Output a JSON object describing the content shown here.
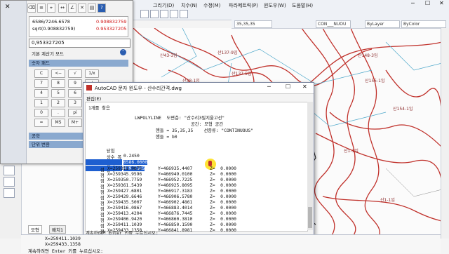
{
  "app": {
    "menu": [
      "그리기(D)",
      "치수(N)",
      "수정(M)",
      "파라메트릭(P)",
      "윈도우(W)",
      "도움말(H)"
    ],
    "toolbar": {
      "coord": "35,35,35",
      "linetype": "CON___NUOU",
      "layer_style": "ByLayer",
      "color": "ByColor"
    }
  },
  "calculator": {
    "history": [
      {
        "expr": "6586/7246.6578",
        "result": "0.908832759"
      },
      {
        "expr": "sqrt(0.908832759)",
        "result": "0.953327205"
      }
    ],
    "input": "0,953327205",
    "basic_mode_label": "기본 계산기 모드",
    "numpad_label": "숫자 패드",
    "keys": [
      [
        "C",
        "<--",
        "√",
        "1/x"
      ],
      [
        "7",
        "8",
        "9",
        "/"
      ],
      [
        "4",
        "5",
        "6",
        "*"
      ],
      [
        "1",
        "2",
        "3",
        "-"
      ],
      [
        "0",
        ".",
        "pi",
        ""
      ],
      [
        "=",
        "MS",
        "M+",
        ""
      ]
    ],
    "sections": [
      "공학",
      "단위 변환"
    ]
  },
  "textwin": {
    "title": "AutoCAD 문자 윈도우 - 산수리간격.dwg",
    "menu": "편집(E)",
    "sub_label": "1개를 찾음",
    "header": [
      "LWPOLYLINE  도면층: \"산수리3필지울고선\"",
      "공간: 모형 공간",
      "핸들 = 35,35,35    선종류: \"CONTINUOUS\"",
      "핸들 = b0"
    ],
    "props": [
      {
        "k": "닫힘",
        "v": ""
      },
      {
        "k": "상수 폭",
        "v": "0.2450"
      },
      {
        "k": "면적",
        "v": "6586.0000"
      },
      {
        "k": "둘레",
        "v": "419.7365"
      }
    ],
    "vertices": [
      {
        "x": "X=259311.9875",
        "y": "Y=466935.4407",
        "z": "Z=  0.0000"
      },
      {
        "x": "X=259345.9596",
        "y": "Y=466949.0100",
        "z": "Z=  0.0000"
      },
      {
        "x": "X=259350.7759",
        "y": "Y=466952.7225",
        "z": "Z=  0.0000"
      },
      {
        "x": "X=259361.5439",
        "y": "Y=466925.8095",
        "z": "Z=  0.0000"
      },
      {
        "x": "X=259427.6801",
        "y": "Y=466917.3183",
        "z": "Z=  0.0000"
      },
      {
        "x": "X=259429.6646",
        "y": "Y=466906.5780",
        "z": "Z=  0.0000"
      },
      {
        "x": "X=259435.5007",
        "y": "Y=466902.4861",
        "z": "Z=  0.0000"
      },
      {
        "x": "X=259416.0867",
        "y": "Y=466883.4014",
        "z": "Z=  0.0000"
      },
      {
        "x": "X=259413.4204",
        "y": "Y=466876.7445",
        "z": "Z=  0.0000"
      },
      {
        "x": "X=259406.9420",
        "y": "Y=466860.3810",
        "z": "Z=  0.0000"
      },
      {
        "x": "X=259411.1039",
        "y": "Y=466850.1590",
        "z": "Z=  0.0000"
      },
      {
        "x": "X=259433.1358",
        "y": "Y=466841.8981",
        "z": "Z=  0.0000"
      }
    ],
    "vertex_label": "점",
    "footer": "계속하려면 Enter 키를 누르십시오:"
  },
  "command": {
    "tabs": [
      "모형",
      "배치1"
    ],
    "lines": [
      "X=259411.1039",
      "X=259433.1358"
    ],
    "prompt": "계속하려면 Enter 키를 누르십시오:"
  },
  "map_labels": [
    "산43-3임",
    "산137-9임",
    "산137-5임",
    "산155-1임",
    "산148-3임",
    "산154-1임",
    "산1-1임",
    "산38-1임",
    "산1-1임"
  ]
}
